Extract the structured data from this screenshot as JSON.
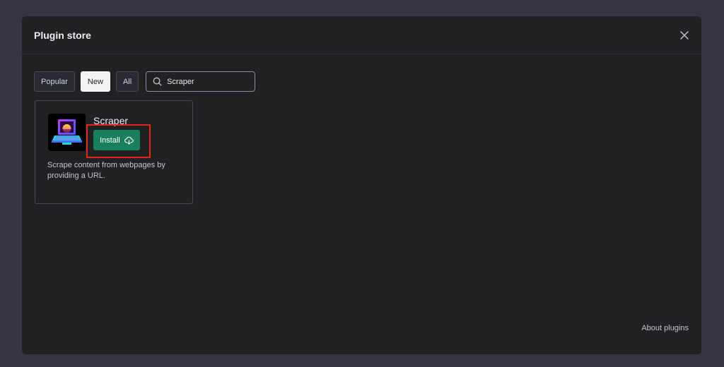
{
  "modal": {
    "title": "Plugin store"
  },
  "filters": {
    "popular_label": "Popular",
    "new_label": "New",
    "all_label": "All",
    "active": "New"
  },
  "search": {
    "value": "Scraper"
  },
  "plugin": {
    "name": "Scraper",
    "install_label": "Install",
    "description": "Scrape content from webpages by providing a URL."
  },
  "footer": {
    "about_label": "About plugins"
  },
  "colors": {
    "page_bg": "#343541",
    "modal_bg": "#202123",
    "install_green": "#19805f",
    "highlight_red": "#e8271c"
  },
  "icons": {
    "close": "close-icon",
    "search": "search-icon",
    "install": "cloud-download-icon"
  }
}
